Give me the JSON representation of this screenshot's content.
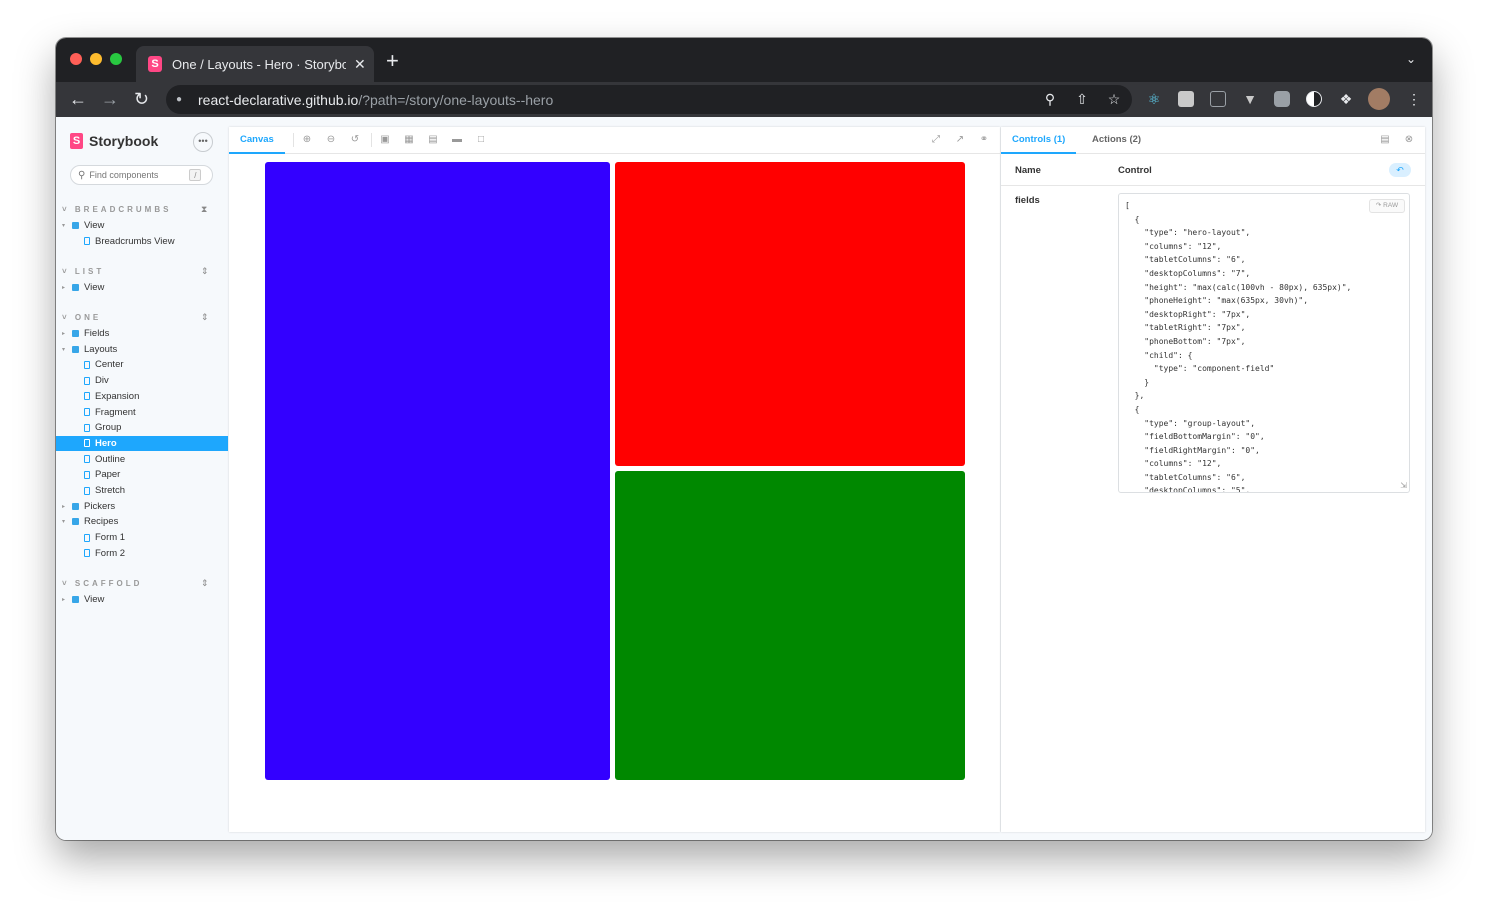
{
  "browser": {
    "tab_title": "One / Layouts - Hero · Storybook",
    "tab_close": "✕",
    "new_tab": "+",
    "url_host": "react-declarative.github.io",
    "url_path": "/?path=/story/one-layouts--hero"
  },
  "sidebar": {
    "brand": "Storybook",
    "search_placeholder": "Find components",
    "search_shortcut": "/",
    "sections": [
      {
        "title": "BREADCRUMBS",
        "items": [
          {
            "type": "folder",
            "label": "View",
            "expanded": true
          },
          {
            "type": "story",
            "label": "Breadcrumbs View"
          }
        ]
      },
      {
        "title": "LIST",
        "items": [
          {
            "type": "folder",
            "label": "View",
            "expanded": false
          }
        ]
      },
      {
        "title": "ONE",
        "items": [
          {
            "type": "folder",
            "label": "Fields",
            "expanded": false
          },
          {
            "type": "folder",
            "label": "Layouts",
            "expanded": true
          },
          {
            "type": "story",
            "label": "Center"
          },
          {
            "type": "story",
            "label": "Div"
          },
          {
            "type": "story",
            "label": "Expansion"
          },
          {
            "type": "story",
            "label": "Fragment"
          },
          {
            "type": "story",
            "label": "Group"
          },
          {
            "type": "story",
            "label": "Hero",
            "active": true
          },
          {
            "type": "story",
            "label": "Outline"
          },
          {
            "type": "story",
            "label": "Paper"
          },
          {
            "type": "story",
            "label": "Stretch"
          },
          {
            "type": "folder",
            "label": "Pickers",
            "expanded": false
          },
          {
            "type": "folder",
            "label": "Recipes",
            "expanded": true
          },
          {
            "type": "story",
            "label": "Form 1"
          },
          {
            "type": "story",
            "label": "Form 2"
          }
        ]
      },
      {
        "title": "SCAFFOLD",
        "items": [
          {
            "type": "folder",
            "label": "View",
            "expanded": false
          }
        ]
      }
    ]
  },
  "preview": {
    "tab_label": "Canvas",
    "blocks": [
      {
        "name": "hero-blue-block",
        "color": "#3300ff"
      },
      {
        "name": "hero-red-block",
        "color": "#ff0000"
      },
      {
        "name": "hero-green-block",
        "color": "#008800"
      }
    ]
  },
  "addons": {
    "tab_controls": "Controls (1)",
    "tab_actions": "Actions (2)",
    "col_name": "Name",
    "col_control": "Control",
    "row_name": "fields",
    "raw_label": "RAW",
    "fields_json": "[\n  {\n    \"type\": \"hero-layout\",\n    \"columns\": \"12\",\n    \"tabletColumns\": \"6\",\n    \"desktopColumns\": \"7\",\n    \"height\": \"max(calc(100vh - 80px), 635px)\",\n    \"phoneHeight\": \"max(635px, 30vh)\",\n    \"desktopRight\": \"7px\",\n    \"tabletRight\": \"7px\",\n    \"phoneBottom\": \"7px\",\n    \"child\": {\n      \"type\": \"component-field\"\n    }\n  },\n  {\n    \"type\": \"group-layout\",\n    \"fieldBottomMargin\": \"0\",\n    \"fieldRightMargin\": \"0\",\n    \"columns\": \"12\",\n    \"tabletColumns\": \"6\",\n    \"desktopColumns\": \"5\","
  }
}
